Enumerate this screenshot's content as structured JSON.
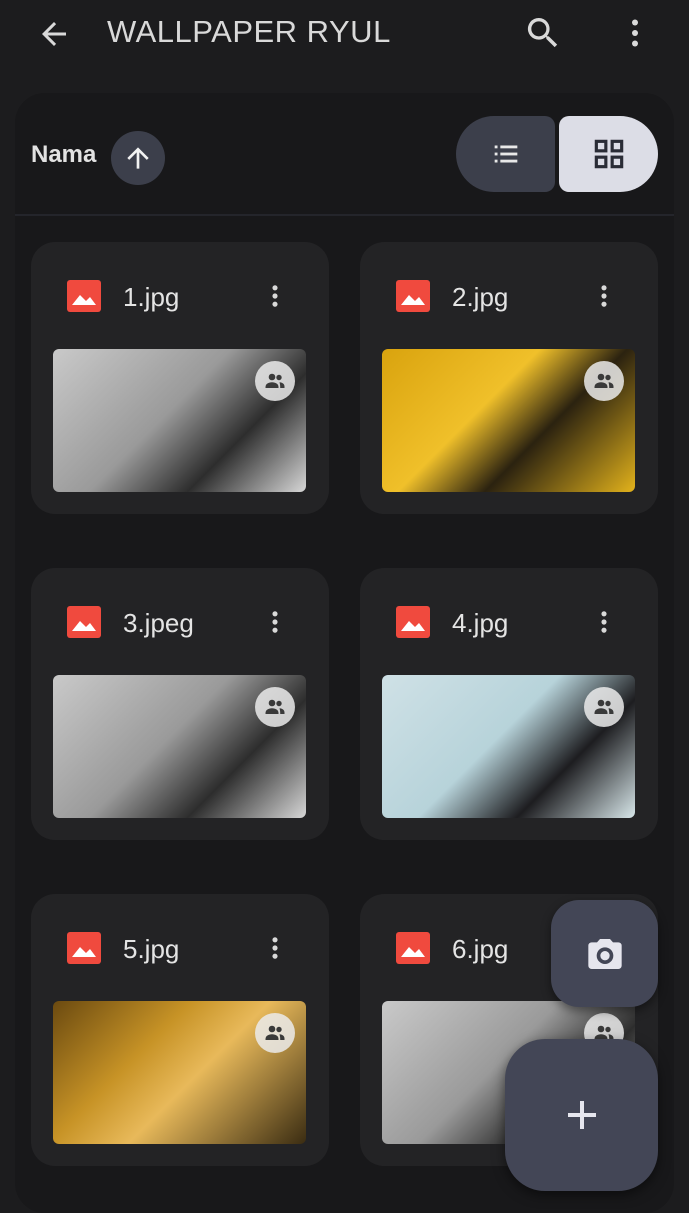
{
  "header": {
    "title": "WALLPAPER RYUL",
    "icons": {
      "back": "arrow-back-icon",
      "search": "search-icon",
      "more": "more-vert-icon"
    }
  },
  "sort": {
    "label": "Nama",
    "direction_icon": "arrow-upward-icon",
    "view_modes": [
      {
        "name": "list",
        "icon": "list-icon",
        "selected": false
      },
      {
        "name": "grid",
        "icon": "grid-icon",
        "selected": true
      }
    ]
  },
  "files": [
    {
      "name": "1.jpg",
      "shared": true,
      "thumb_tone": "grayscale"
    },
    {
      "name": "2.jpg",
      "shared": true,
      "thumb_tone": "yellow"
    },
    {
      "name": "3.jpeg",
      "shared": true,
      "thumb_tone": "grayscale"
    },
    {
      "name": "4.jpg",
      "shared": true,
      "thumb_tone": "light-blue"
    },
    {
      "name": "5.jpg",
      "shared": true,
      "thumb_tone": "warm-yellow"
    },
    {
      "name": "6.jpg",
      "shared": true,
      "thumb_tone": "grayscale"
    }
  ],
  "fabs": {
    "camera": "camera-icon",
    "add": "add-icon"
  },
  "colors": {
    "background": "#1c1c1e",
    "card": "#232325",
    "image_icon": "#f04a3e",
    "fab": "#434656",
    "selected_toggle": "#dcdde6"
  }
}
